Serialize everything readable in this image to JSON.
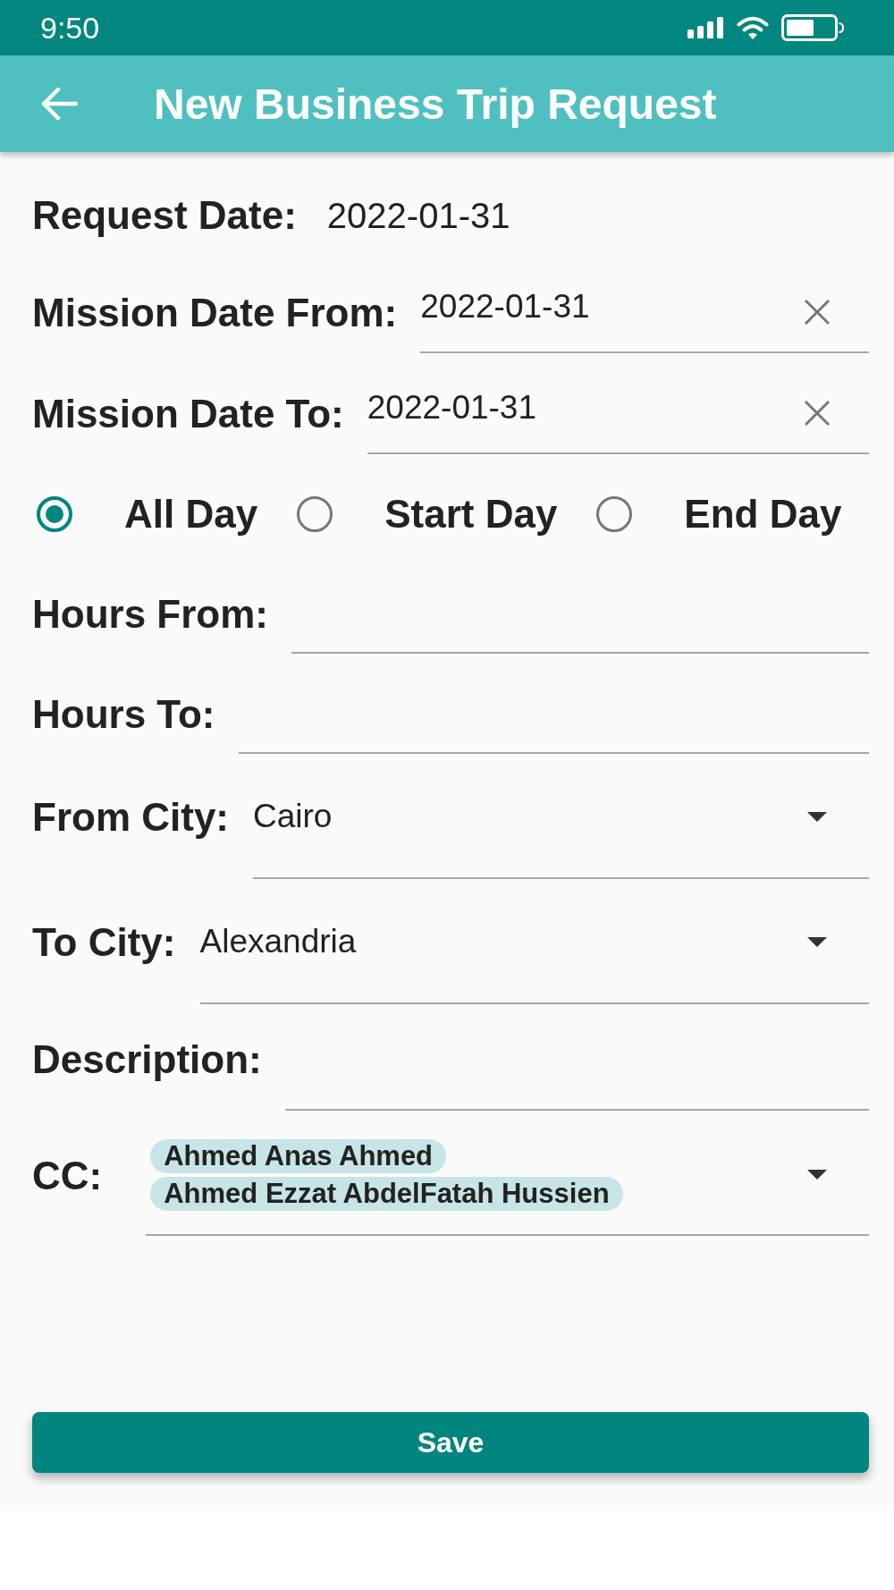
{
  "status_bar": {
    "time": "9:50"
  },
  "app_bar": {
    "title": "New Business Trip Request"
  },
  "form": {
    "fields": [
      {
        "kind": "static",
        "label": "Request Date:",
        "value": "2022-01-31"
      },
      {
        "kind": "date",
        "label": "Mission Date From:",
        "value": "2022-01-31"
      },
      {
        "kind": "date",
        "label": "Mission Date To:",
        "value": "2022-01-31"
      },
      {
        "kind": "radio",
        "options": [
          {
            "label": "All Day",
            "selected": true
          },
          {
            "label": "Start Day",
            "selected": false
          },
          {
            "label": "End Day",
            "selected": false
          }
        ]
      },
      {
        "kind": "time",
        "label": "Hours From:"
      },
      {
        "kind": "time",
        "label": "Hours To:"
      },
      {
        "kind": "dropdown",
        "label": "From City:",
        "value": "Cairo"
      },
      {
        "kind": "dropdown",
        "label": "To City:",
        "value": "Alexandria"
      },
      {
        "kind": "textarea",
        "label": "Description:"
      },
      {
        "kind": "multiselect",
        "label": "CC:",
        "chips": [
          "Ahmed Anas Ahmed",
          "Ahmed Ezzat AbdelFatah Hussien"
        ]
      }
    ]
  },
  "save_button": {
    "label": "Save"
  }
}
